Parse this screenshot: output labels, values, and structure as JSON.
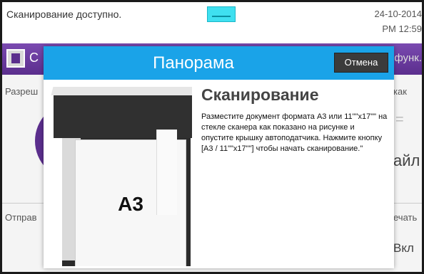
{
  "status": {
    "message": "Сканирование доступно.",
    "date": "24-10-2014",
    "time": "PM 12:59"
  },
  "background": {
    "top_letter": "С",
    "func_label": "функ.",
    "resolution_label": "Разреш",
    "save_as_label": "как",
    "file_label": "айл",
    "send_label": "Отправ",
    "print_label": "ечать",
    "toggle_value": "Вкл",
    "equals_glyph": "="
  },
  "dialog": {
    "title": "Панорама",
    "cancel_label": "Отмена",
    "heading": "Сканирование",
    "instructions": "Разместите документ формата А3 или 11\"\"x17\"\" на стекле сканера как показано на рисунке и опустите крышку автоподатчика. Нажмите кнопку [А3 / 11\"\"x17\"\"] чтобы начать сканирование.\"",
    "illustration_label": "A3"
  },
  "colors": {
    "header_blue": "#1aa3e8",
    "topbar_purple": "#5b2e8d",
    "handle_cyan": "#3fe0f0"
  }
}
